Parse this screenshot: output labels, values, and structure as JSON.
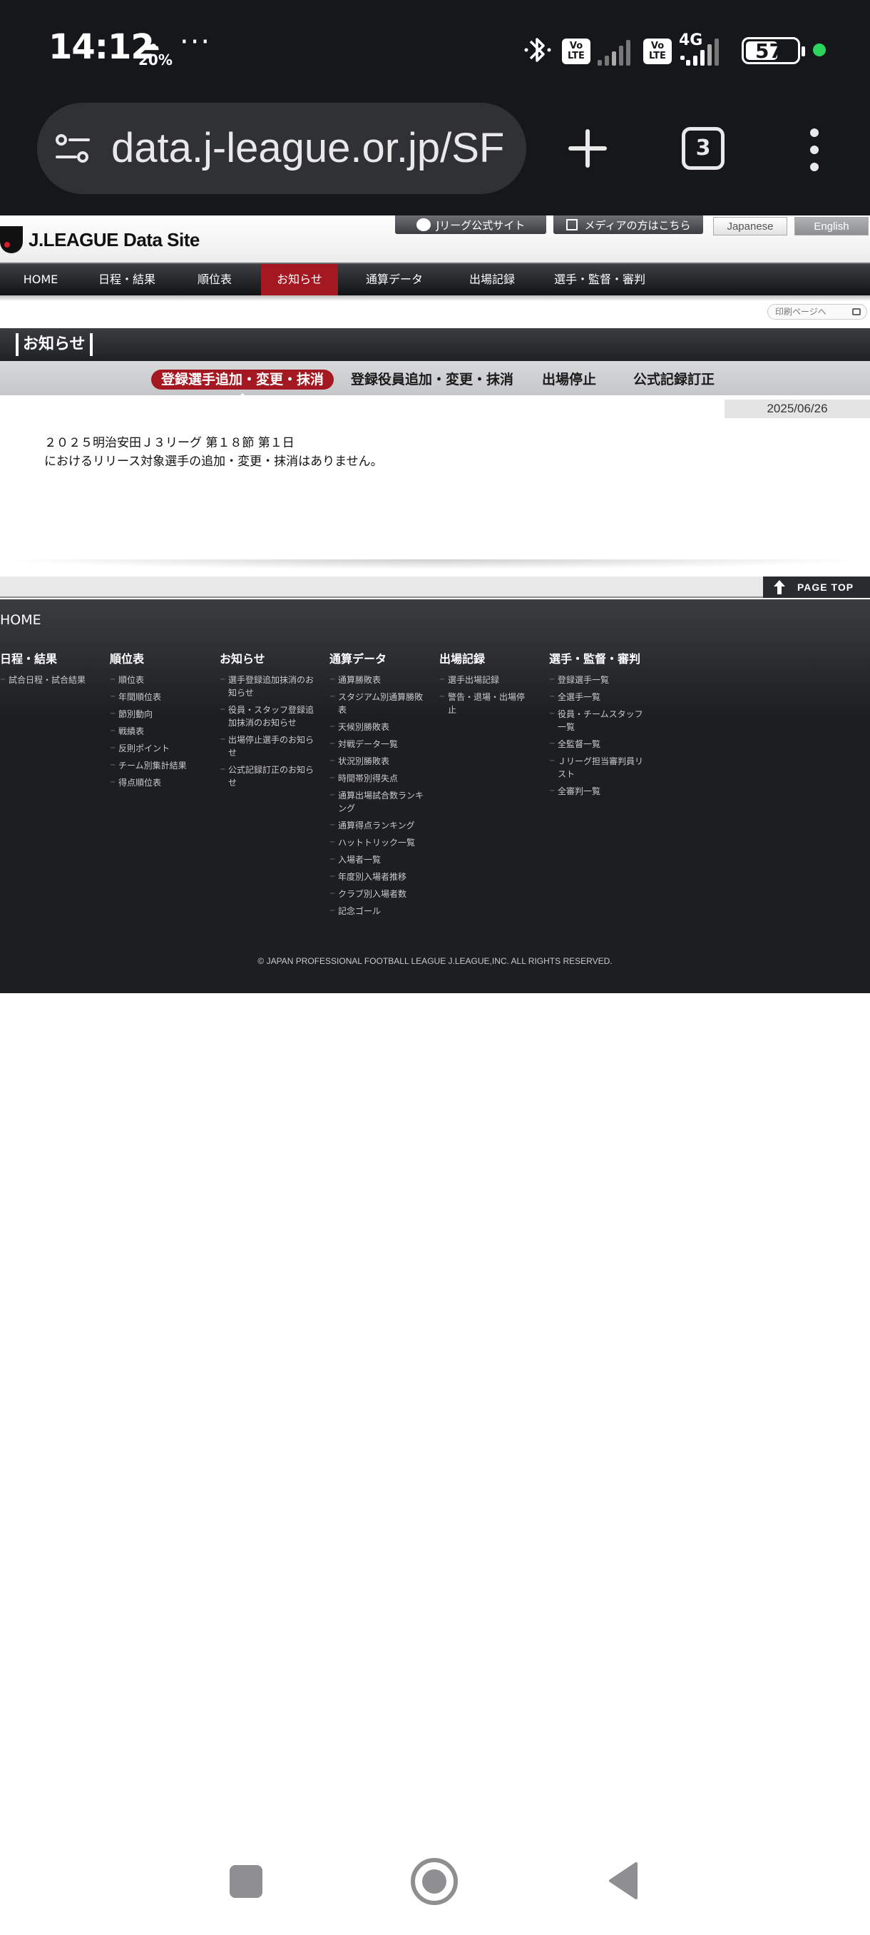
{
  "status_bar": {
    "time": "14:12",
    "weather_percent": "20%",
    "overflow": "···",
    "volte_label": "Vo\nLTE",
    "network": "4G",
    "battery": "57"
  },
  "browser": {
    "url": "data.j-league.or.jp/SF",
    "tab_count": "3"
  },
  "site": {
    "logo_text": "J.LEAGUE",
    "logo_sub": "Data Site",
    "official_site": "Jリーグ公式サイト",
    "media": "メディアの方はこちら",
    "lang_japanese": "Japanese",
    "lang_english": "English"
  },
  "global_nav": [
    {
      "label": "HOME"
    },
    {
      "label": "日程・結果"
    },
    {
      "label": "順位表"
    },
    {
      "label": "お知らせ"
    },
    {
      "label": "通算データ"
    },
    {
      "label": "出場記録"
    },
    {
      "label": "選手・監督・審判"
    }
  ],
  "print_link": "印刷ページへ",
  "section_title": "お知らせ",
  "subtabs": [
    {
      "label": "登録選手追加・変更・抹消"
    },
    {
      "label": "登録役員追加・変更・抹消"
    },
    {
      "label": "出場停止"
    },
    {
      "label": "公式記録訂正"
    }
  ],
  "date": "2025/06/26",
  "notice": {
    "line1": "２０２５明治安田Ｊ３リーグ 第１８節 第１日",
    "line2": "におけるリリース対象選手の追加・変更・抹消はありません。"
  },
  "page_top": "PAGE TOP",
  "footer": {
    "home": "HOME",
    "columns": [
      {
        "title": "日程・結果",
        "items": [
          "試合日程・試合結果"
        ]
      },
      {
        "title": "順位表",
        "items": [
          "順位表",
          "年間順位表",
          "節別動向",
          "戦績表",
          "反則ポイント",
          "チーム別集計結果",
          "得点順位表"
        ]
      },
      {
        "title": "お知らせ",
        "items": [
          "選手登録追加抹消のお知らせ",
          "役員・スタッフ登録追加抹消のお知らせ",
          "出場停止選手のお知らせ",
          "公式記録訂正のお知らせ"
        ]
      },
      {
        "title": "通算データ",
        "items": [
          "通算勝敗表",
          "スタジアム別通算勝敗表",
          "天候別勝敗表",
          "対戦データ一覧",
          "状況別勝敗表",
          "時間帯別得失点",
          "通算出場試合数ランキング",
          "通算得点ランキング",
          "ハットトリック一覧",
          "入場者一覧",
          "年度別入場者推移",
          "クラブ別入場者数",
          "記念ゴール"
        ]
      },
      {
        "title": "出場記録",
        "items": [
          "選手出場記録",
          "警告・退場・出場停止"
        ]
      },
      {
        "title": "選手・監督・審判",
        "items": [
          "登録選手一覧",
          "全選手一覧",
          "役員・チームスタッフ一覧",
          "全監督一覧",
          "Ｊリーグ担当審判員リスト",
          "全審判一覧"
        ]
      }
    ],
    "copyright": "© JAPAN PROFESSIONAL FOOTBALL LEAGUE J.LEAGUE,INC. ALL RIGHTS RESERVED."
  },
  "colors": {
    "accent": "#a31821",
    "dark": "#1d1e21",
    "status_green": "#2bd55b"
  }
}
